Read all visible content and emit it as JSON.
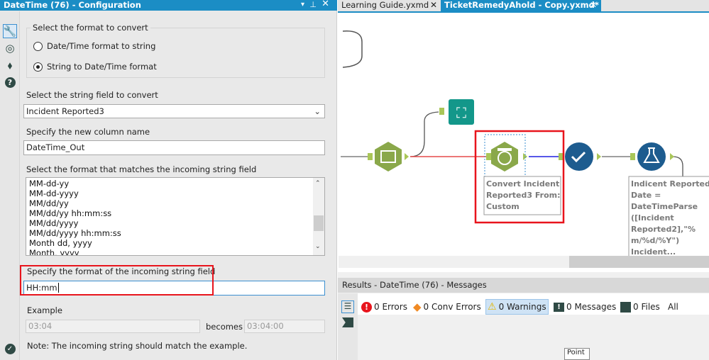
{
  "config": {
    "title": "DateTime (76) - Configuration",
    "group_label": "Select the format to convert",
    "radio_options": [
      {
        "label": "Date/Time format to string",
        "checked": false
      },
      {
        "label": "String to Date/Time format",
        "checked": true
      }
    ],
    "string_field_label": "Select the string field to convert",
    "string_field_value": "Incident Reported3",
    "new_column_label": "Specify the new column name",
    "new_column_value": "DateTime_Out",
    "format_list_label": "Select the format that matches the incoming string field",
    "format_list": [
      "MM-dd-yy",
      "MM-dd-yyyy",
      "MM/dd/yy",
      "MM/dd/yy hh:mm:ss",
      "MM/dd/yyyy",
      "MM/dd/yyyy hh:mm:ss",
      "Month dd, yyyy",
      "Month, yyyy"
    ],
    "custom_format_label": "Specify the format of the incoming string field",
    "custom_format_value": "HH:mm",
    "example_label": "Example",
    "example_input": "03:04",
    "becomes_label": "becomes",
    "example_output": "03:04:00",
    "note": "Note: The incoming string should match the example."
  },
  "tabs": [
    {
      "label": "Learning Guide.yxmd",
      "active": false
    },
    {
      "label": "TicketRemedyAhold - Copy.yxmd*",
      "active": true
    }
  ],
  "canvas": {
    "datetime_annotation": [
      "Convert Incident",
      "Reported3 From:",
      "Custom"
    ],
    "formula_annotation": [
      "Indicent Reported",
      "Date =",
      "DateTimeParse",
      "([Incident",
      "Reported2],\"%",
      "m/%d/%Y\")",
      "Incident..."
    ],
    "tooltip": "Point"
  },
  "results": {
    "title": "Results - DateTime (76) - Messages",
    "errors": "0 Errors",
    "conv_errors": "0 Conv Errors",
    "warnings": "0 Warnings",
    "messages": "0 Messages",
    "files": "0 Files",
    "all": "All"
  },
  "colors": {
    "accent": "#1b8dc5",
    "highlight": "#e8141c",
    "tool_green": "#8aa84a",
    "tool_blue": "#1d5c8f",
    "browse_teal": "#13978a"
  }
}
